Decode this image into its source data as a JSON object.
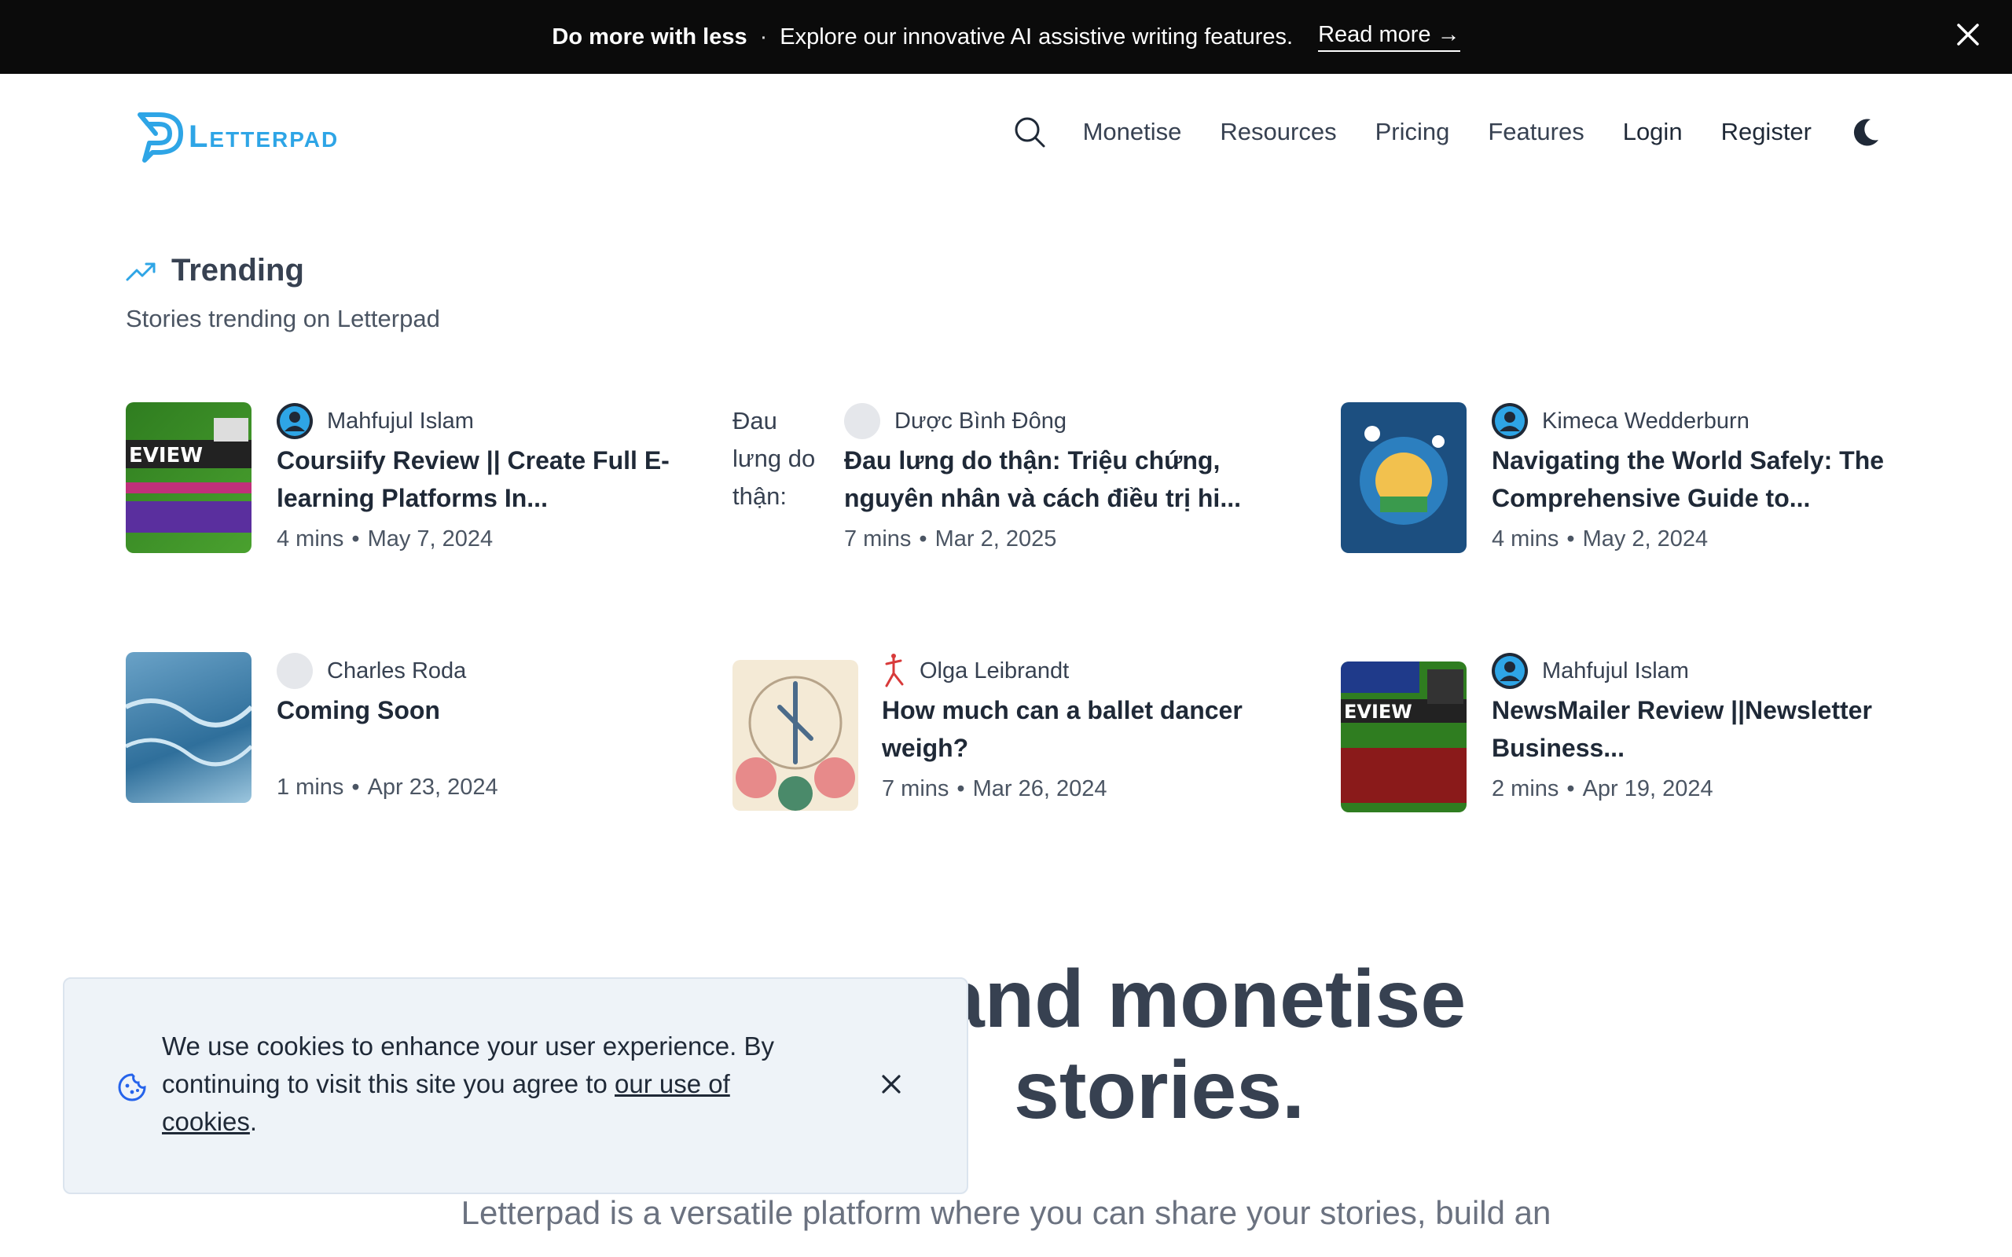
{
  "banner": {
    "strong": "Do more with less",
    "dot": "·",
    "message": "Explore our innovative AI assistive writing features.",
    "read_more": "Read more →"
  },
  "header": {
    "logo_text": "Letterpad",
    "nav": [
      "Monetise",
      "Resources",
      "Pricing",
      "Features",
      "Login",
      "Register"
    ],
    "brand_color": "#2ea5e6"
  },
  "trending": {
    "title": "Trending",
    "subtitle": "Stories trending on Letterpad",
    "posts": [
      {
        "author": "Mahfujul Islam",
        "title": "Coursiify Review || Create Full E-learning Platforms In...",
        "read": "4 mins",
        "date": "May 7, 2024"
      },
      {
        "author": "Dược Bình Đông",
        "title": "Đau lưng do thận: Triệu chứng, nguyên nhân và cách điều trị hi...",
        "read": "7 mins",
        "date": "Mar 2, 2025",
        "img_alt": "Đau lưng do thận:"
      },
      {
        "author": "Kimeca Wedderburn",
        "title": "Navigating the World Safely: The Comprehensive Guide to...",
        "read": "4 mins",
        "date": "May 2, 2024"
      },
      {
        "author": "Charles Roda",
        "title": "Coming Soon",
        "read": "1 mins",
        "date": "Apr 23, 2024"
      },
      {
        "author": "Olga Leibrandt",
        "title": "How much can a ballet dancer weigh?",
        "read": "7 mins",
        "date": "Mar 26, 2024"
      },
      {
        "author": "Mahfujul Islam",
        "title": "NewsMailer Review ||Newsletter Business...",
        "read": "2 mins",
        "date": "Apr 19, 2024"
      }
    ],
    "separator": "•"
  },
  "hero": {
    "line1": "and monetise",
    "line2": "stories.",
    "sub": "Letterpad is a versatile platform where you can share your stories, build an"
  },
  "cookie": {
    "text": "We use cookies to enhance your user experience. By continuing to visit this site you agree to ",
    "link": "our use of cookies",
    "end": "."
  }
}
